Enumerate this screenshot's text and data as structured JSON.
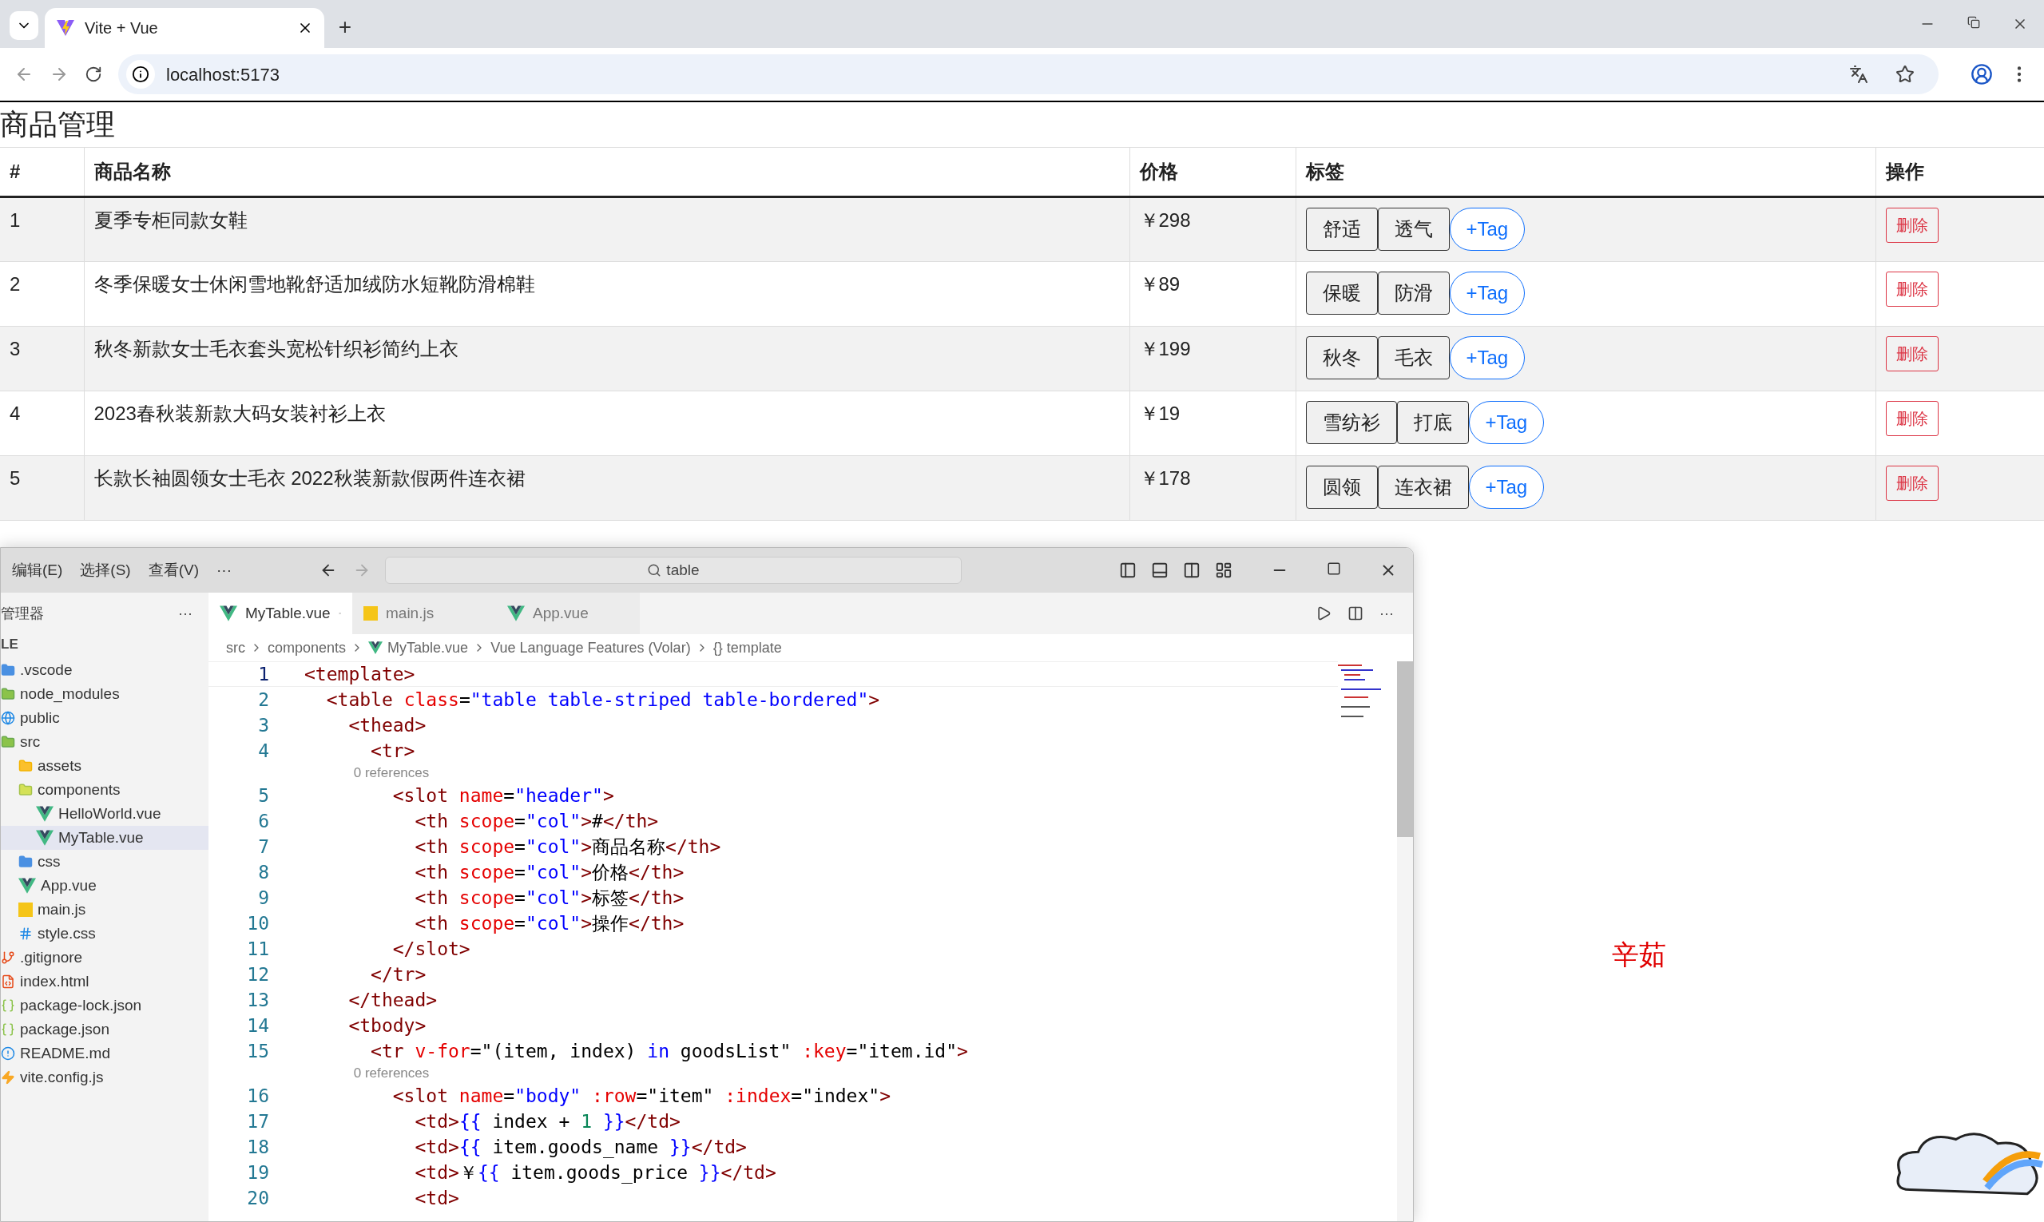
{
  "browser": {
    "tabs": [
      {
        "title": "Vite + Vue",
        "selected": true
      }
    ],
    "new_tab": "+",
    "url": "localhost:5173"
  },
  "page": {
    "title": "商品管理",
    "note": "辛茹",
    "table": {
      "columns": [
        "#",
        "商品名称",
        "价格",
        "标签",
        "操作"
      ],
      "rows": [
        {
          "index": "1",
          "name": "夏季专柜同款女鞋",
          "price": "￥298",
          "tags": [
            "舒适",
            "透气"
          ],
          "add_tag": "+Tag",
          "action": "删除"
        },
        {
          "index": "2",
          "name": "冬季保暖女士休闲雪地靴舒适加绒防水短靴防滑棉鞋",
          "price": "￥89",
          "tags": [
            "保暖",
            "防滑"
          ],
          "add_tag": "+Tag",
          "action": "删除"
        },
        {
          "index": "3",
          "name": "秋冬新款女士毛衣套头宽松针织衫简约上衣",
          "price": "￥199",
          "tags": [
            "秋冬",
            "毛衣"
          ],
          "add_tag": "+Tag",
          "action": "删除"
        },
        {
          "index": "4",
          "name": "2023春秋装新款大码女装衬衫上衣",
          "price": "￥19",
          "tags": [
            "雪纺衫",
            "打底"
          ],
          "add_tag": "+Tag",
          "action": "删除"
        },
        {
          "index": "5",
          "name": "长款长袖圆领女士毛衣 2022秋装新款假两件连衣裙",
          "price": "￥178",
          "tags": [
            "圆领",
            "连衣裙"
          ],
          "add_tag": "+Tag",
          "action": "删除"
        }
      ]
    }
  },
  "editor": {
    "menu": [
      "编辑(E)",
      "选择(S)",
      "查看(V)",
      "···"
    ],
    "search": "table",
    "sidebar": {
      "title": "管理器",
      "more": "···",
      "section": "LE",
      "items": [
        {
          "label": ".vscode",
          "kind": "folder-blue",
          "selected": false
        },
        {
          "label": "node_modules",
          "kind": "folder-green",
          "selected": false
        },
        {
          "label": "public",
          "kind": "globe",
          "selected": false
        },
        {
          "label": "src",
          "kind": "folder-green",
          "selected": false,
          "children": [
            {
              "label": "assets",
              "kind": "folder-yellow",
              "selected": false
            },
            {
              "label": "components",
              "kind": "folder-lime",
              "selected": false,
              "children": [
                {
                  "label": "HelloWorld.vue",
                  "kind": "vue",
                  "selected": false
                },
                {
                  "label": "MyTable.vue",
                  "kind": "vue",
                  "selected": true
                }
              ]
            },
            {
              "label": "css",
              "kind": "folder-blue",
              "selected": false
            },
            {
              "label": "App.vue",
              "kind": "vue",
              "selected": false
            },
            {
              "label": "main.js",
              "kind": "js",
              "selected": false
            },
            {
              "label": "style.css",
              "kind": "css",
              "selected": false
            }
          ]
        },
        {
          "label": ".gitignore",
          "kind": "git",
          "selected": false
        },
        {
          "label": "index.html",
          "kind": "html",
          "selected": false
        },
        {
          "label": "package-lock.json",
          "kind": "json",
          "selected": false
        },
        {
          "label": "package.json",
          "kind": "json",
          "selected": false
        },
        {
          "label": "README.md",
          "kind": "info",
          "selected": false
        },
        {
          "label": "vite.config.js",
          "kind": "bolt",
          "selected": false
        }
      ]
    },
    "tabs": [
      {
        "label": "MyTable.vue",
        "kind": "vue",
        "selected": true
      },
      {
        "label": "main.js",
        "kind": "js",
        "selected": false
      },
      {
        "label": "App.vue",
        "kind": "vue",
        "selected": false
      }
    ],
    "tab_more": "···",
    "breadcrumb": [
      "src",
      "components",
      "MyTable.vue",
      "Vue Language Features (Volar)",
      "{} template"
    ],
    "lines": [
      {
        "kind": "code",
        "number": "1",
        "tokens": [
          {
            "kind": "tag",
            "text": "<template>"
          }
        ]
      },
      {
        "kind": "code",
        "number": "2",
        "tokens": [
          {
            "kind": "tag",
            "text": "  <table"
          },
          {
            "kind": "attr",
            "text": " class"
          },
          {
            "kind": "text",
            "text": "="
          },
          {
            "kind": "str",
            "text": "\"table table-striped table-bordered\""
          },
          {
            "kind": "tag",
            "text": ">"
          }
        ]
      },
      {
        "kind": "code",
        "number": "3",
        "tokens": [
          {
            "kind": "tag",
            "text": "    <thead>"
          }
        ]
      },
      {
        "kind": "code",
        "number": "4",
        "tokens": [
          {
            "kind": "tag",
            "text": "      <tr>"
          }
        ]
      },
      {
        "kind": "lens",
        "text": "        0 references"
      },
      {
        "kind": "code",
        "number": "5",
        "tokens": [
          {
            "kind": "tag",
            "text": "        <slot"
          },
          {
            "kind": "attr",
            "text": " name"
          },
          {
            "kind": "text",
            "text": "="
          },
          {
            "kind": "str",
            "text": "\"header\""
          },
          {
            "kind": "tag",
            "text": ">"
          }
        ]
      },
      {
        "kind": "code",
        "number": "6",
        "tokens": [
          {
            "kind": "tag",
            "text": "          <th"
          },
          {
            "kind": "attr",
            "text": " scope"
          },
          {
            "kind": "text",
            "text": "="
          },
          {
            "kind": "str",
            "text": "\"col\""
          },
          {
            "kind": "tag",
            "text": ">"
          },
          {
            "kind": "text",
            "text": "#"
          },
          {
            "kind": "tag",
            "text": "</th>"
          }
        ]
      },
      {
        "kind": "code",
        "number": "7",
        "tokens": [
          {
            "kind": "tag",
            "text": "          <th"
          },
          {
            "kind": "attr",
            "text": " scope"
          },
          {
            "kind": "text",
            "text": "="
          },
          {
            "kind": "str",
            "text": "\"col\""
          },
          {
            "kind": "tag",
            "text": ">"
          },
          {
            "kind": "text",
            "text": "商品名称"
          },
          {
            "kind": "tag",
            "text": "</th>"
          }
        ]
      },
      {
        "kind": "code",
        "number": "8",
        "tokens": [
          {
            "kind": "tag",
            "text": "          <th"
          },
          {
            "kind": "attr",
            "text": " scope"
          },
          {
            "kind": "text",
            "text": "="
          },
          {
            "kind": "str",
            "text": "\"col\""
          },
          {
            "kind": "tag",
            "text": ">"
          },
          {
            "kind": "text",
            "text": "价格"
          },
          {
            "kind": "tag",
            "text": "</th>"
          }
        ]
      },
      {
        "kind": "code",
        "number": "9",
        "tokens": [
          {
            "kind": "tag",
            "text": "          <th"
          },
          {
            "kind": "attr",
            "text": " scope"
          },
          {
            "kind": "text",
            "text": "="
          },
          {
            "kind": "str",
            "text": "\"col\""
          },
          {
            "kind": "tag",
            "text": ">"
          },
          {
            "kind": "text",
            "text": "标签"
          },
          {
            "kind": "tag",
            "text": "</th>"
          }
        ]
      },
      {
        "kind": "code",
        "number": "10",
        "tokens": [
          {
            "kind": "tag",
            "text": "          <th"
          },
          {
            "kind": "attr",
            "text": " scope"
          },
          {
            "kind": "text",
            "text": "="
          },
          {
            "kind": "str",
            "text": "\"col\""
          },
          {
            "kind": "tag",
            "text": ">"
          },
          {
            "kind": "text",
            "text": "操作"
          },
          {
            "kind": "tag",
            "text": "</th>"
          }
        ]
      },
      {
        "kind": "code",
        "number": "11",
        "tokens": [
          {
            "kind": "tag",
            "text": "        </slot>"
          }
        ]
      },
      {
        "kind": "code",
        "number": "12",
        "tokens": [
          {
            "kind": "tag",
            "text": "      </tr>"
          }
        ]
      },
      {
        "kind": "code",
        "number": "13",
        "tokens": [
          {
            "kind": "tag",
            "text": "    </thead>"
          }
        ]
      },
      {
        "kind": "code",
        "number": "14",
        "tokens": [
          {
            "kind": "tag",
            "text": "    <tbody>"
          }
        ]
      },
      {
        "kind": "code",
        "number": "15",
        "tokens": [
          {
            "kind": "tag",
            "text": "      <tr"
          },
          {
            "kind": "attr",
            "text": " v-for"
          },
          {
            "kind": "text",
            "text": "=\"(item, index) "
          },
          {
            "kind": "brace",
            "text": "in"
          },
          {
            "kind": "text",
            "text": " goodsList\""
          },
          {
            "kind": "attr",
            "text": " :key"
          },
          {
            "kind": "text",
            "text": "=\"item.id\""
          },
          {
            "kind": "tag",
            "text": ">"
          }
        ]
      },
      {
        "kind": "lens",
        "text": "        0 references"
      },
      {
        "kind": "code",
        "number": "16",
        "tokens": [
          {
            "kind": "tag",
            "text": "        <slot"
          },
          {
            "kind": "attr",
            "text": " name"
          },
          {
            "kind": "text",
            "text": "="
          },
          {
            "kind": "str",
            "text": "\"body\""
          },
          {
            "kind": "attr",
            "text": " :row"
          },
          {
            "kind": "text",
            "text": "=\"item\""
          },
          {
            "kind": "attr",
            "text": " :index"
          },
          {
            "kind": "text",
            "text": "=\"index\""
          },
          {
            "kind": "tag",
            "text": ">"
          }
        ]
      },
      {
        "kind": "code",
        "number": "17",
        "tokens": [
          {
            "kind": "tag",
            "text": "          <td>"
          },
          {
            "kind": "brace",
            "text": "{{"
          },
          {
            "kind": "text",
            "text": " index + "
          },
          {
            "kind": "num",
            "text": "1"
          },
          {
            "kind": "brace",
            "text": " }}"
          },
          {
            "kind": "tag",
            "text": "</td>"
          }
        ]
      },
      {
        "kind": "code",
        "number": "18",
        "tokens": [
          {
            "kind": "tag",
            "text": "          <td>"
          },
          {
            "kind": "brace",
            "text": "{{"
          },
          {
            "kind": "text",
            "text": " item.goods_name "
          },
          {
            "kind": "brace",
            "text": "}}"
          },
          {
            "kind": "tag",
            "text": "</td>"
          }
        ]
      },
      {
        "kind": "code",
        "number": "19",
        "tokens": [
          {
            "kind": "tag",
            "text": "          <td>"
          },
          {
            "kind": "text",
            "text": "￥"
          },
          {
            "kind": "brace",
            "text": "{{"
          },
          {
            "kind": "text",
            "text": " item.goods_price "
          },
          {
            "kind": "brace",
            "text": "}}"
          },
          {
            "kind": "tag",
            "text": "</td>"
          }
        ]
      },
      {
        "kind": "code",
        "number": "20",
        "tokens": [
          {
            "kind": "tag",
            "text": "          <td>"
          }
        ]
      }
    ]
  }
}
